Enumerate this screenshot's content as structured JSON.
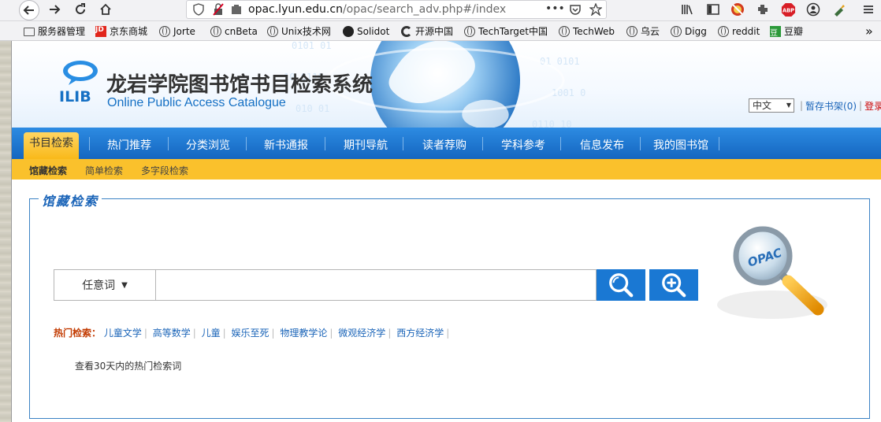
{
  "browser": {
    "url_host": "opac.lyun.edu.cn",
    "url_path": "/opac/search_adv.php#/index",
    "url_menu": "•••"
  },
  "bookmarks": [
    {
      "label": "服务器管理",
      "icon": "folder-icon"
    },
    {
      "label": "京东商城",
      "icon": "jd-icon",
      "badge": "JD"
    },
    {
      "label": "Jorte",
      "icon": "globe-icon"
    },
    {
      "label": "cnBeta",
      "icon": "globe-icon"
    },
    {
      "label": "Unix技术网",
      "icon": "globe-icon"
    },
    {
      "label": "Solidot",
      "icon": "solidot-icon"
    },
    {
      "label": "开源中国",
      "icon": "oschina-icon"
    },
    {
      "label": "TechTarget中国",
      "icon": "globe-icon"
    },
    {
      "label": "TechWeb",
      "icon": "globe-icon"
    },
    {
      "label": "乌云",
      "icon": "globe-icon"
    },
    {
      "label": "Digg",
      "icon": "globe-icon"
    },
    {
      "label": "reddit",
      "icon": "globe-icon"
    },
    {
      "label": "豆瓣",
      "icon": "douban-icon",
      "badge": "豆"
    }
  ],
  "header": {
    "logo_text": "ILIB",
    "title": "龙岩学院图书馆书目检索系统",
    "subtitle": "Online Public Access Catalogue",
    "language": "中文",
    "shelf_link": "暂存书架(0)",
    "login_link": "登录"
  },
  "nav": {
    "items": [
      "书目检索",
      "热门推荐",
      "分类浏览",
      "新书通报",
      "期刊导航",
      "读者荐购",
      "学科参考",
      "信息发布",
      "我的图书馆"
    ],
    "active": "书目检索"
  },
  "subnav": {
    "items": [
      "馆藏检索",
      "简单检索",
      "多字段检索"
    ],
    "active": "馆藏检索"
  },
  "search": {
    "panel_title": "馆藏检索",
    "type_label": "任意词",
    "input_value": "",
    "hot_label": "热门检索：",
    "hot_terms": [
      "儿童文学",
      "高等数学",
      "儿童",
      "娱乐至死",
      "物理教学论",
      "微观经济学",
      "西方经济学"
    ],
    "hot_30_days": "查看30天内的热门检索词",
    "opac_badge": "OPAC"
  },
  "colors": {
    "nav_blue": "#1a78d3",
    "nav_active": "#fac12c",
    "hot_label": "#c23a00",
    "link": "#1a64b8"
  }
}
